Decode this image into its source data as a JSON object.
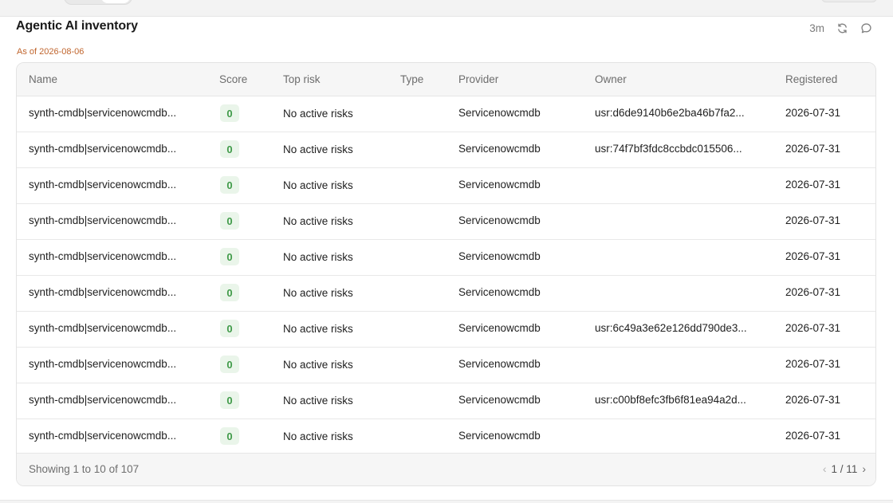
{
  "panel": {
    "title": "Agentic AI inventory",
    "as_of": "As of 2026-08-06",
    "refresh_interval": "3m"
  },
  "icons": {
    "refresh": "refresh-icon",
    "comment": "comment-icon"
  },
  "colors": {
    "as_of_text": "#c0652d",
    "score_badge_bg": "#eaf5ea",
    "score_badge_text": "#3f9a48"
  },
  "table": {
    "columns": {
      "name": "Name",
      "score": "Score",
      "top_risk": "Top risk",
      "type": "Type",
      "provider": "Provider",
      "owner": "Owner",
      "registered": "Registered"
    },
    "rows": [
      {
        "name": "synth-cmdb|servicenowcmdb...",
        "score": "0",
        "top_risk": "No active risks",
        "type": "",
        "provider": "Servicenowcmdb",
        "owner": "usr:d6de9140b6e2ba46b7fa2...",
        "registered": "2026-07-31"
      },
      {
        "name": "synth-cmdb|servicenowcmdb...",
        "score": "0",
        "top_risk": "No active risks",
        "type": "",
        "provider": "Servicenowcmdb",
        "owner": "usr:74f7bf3fdc8ccbdc015506...",
        "registered": "2026-07-31"
      },
      {
        "name": "synth-cmdb|servicenowcmdb...",
        "score": "0",
        "top_risk": "No active risks",
        "type": "",
        "provider": "Servicenowcmdb",
        "owner": "",
        "registered": "2026-07-31"
      },
      {
        "name": "synth-cmdb|servicenowcmdb...",
        "score": "0",
        "top_risk": "No active risks",
        "type": "",
        "provider": "Servicenowcmdb",
        "owner": "",
        "registered": "2026-07-31"
      },
      {
        "name": "synth-cmdb|servicenowcmdb...",
        "score": "0",
        "top_risk": "No active risks",
        "type": "",
        "provider": "Servicenowcmdb",
        "owner": "",
        "registered": "2026-07-31"
      },
      {
        "name": "synth-cmdb|servicenowcmdb...",
        "score": "0",
        "top_risk": "No active risks",
        "type": "",
        "provider": "Servicenowcmdb",
        "owner": "",
        "registered": "2026-07-31"
      },
      {
        "name": "synth-cmdb|servicenowcmdb...",
        "score": "0",
        "top_risk": "No active risks",
        "type": "",
        "provider": "Servicenowcmdb",
        "owner": "usr:6c49a3e62e126dd790de3...",
        "registered": "2026-07-31"
      },
      {
        "name": "synth-cmdb|servicenowcmdb...",
        "score": "0",
        "top_risk": "No active risks",
        "type": "",
        "provider": "Servicenowcmdb",
        "owner": "",
        "registered": "2026-07-31"
      },
      {
        "name": "synth-cmdb|servicenowcmdb...",
        "score": "0",
        "top_risk": "No active risks",
        "type": "",
        "provider": "Servicenowcmdb",
        "owner": "usr:c00bf8efc3fb6f81ea94a2d...",
        "registered": "2026-07-31"
      },
      {
        "name": "synth-cmdb|servicenowcmdb...",
        "score": "0",
        "top_risk": "No active risks",
        "type": "",
        "provider": "Servicenowcmdb",
        "owner": "",
        "registered": "2026-07-31"
      }
    ],
    "footer": {
      "showing": "Showing 1 to 10 of 107",
      "page": "1 / 11",
      "prev": "‹",
      "next": "›"
    }
  }
}
